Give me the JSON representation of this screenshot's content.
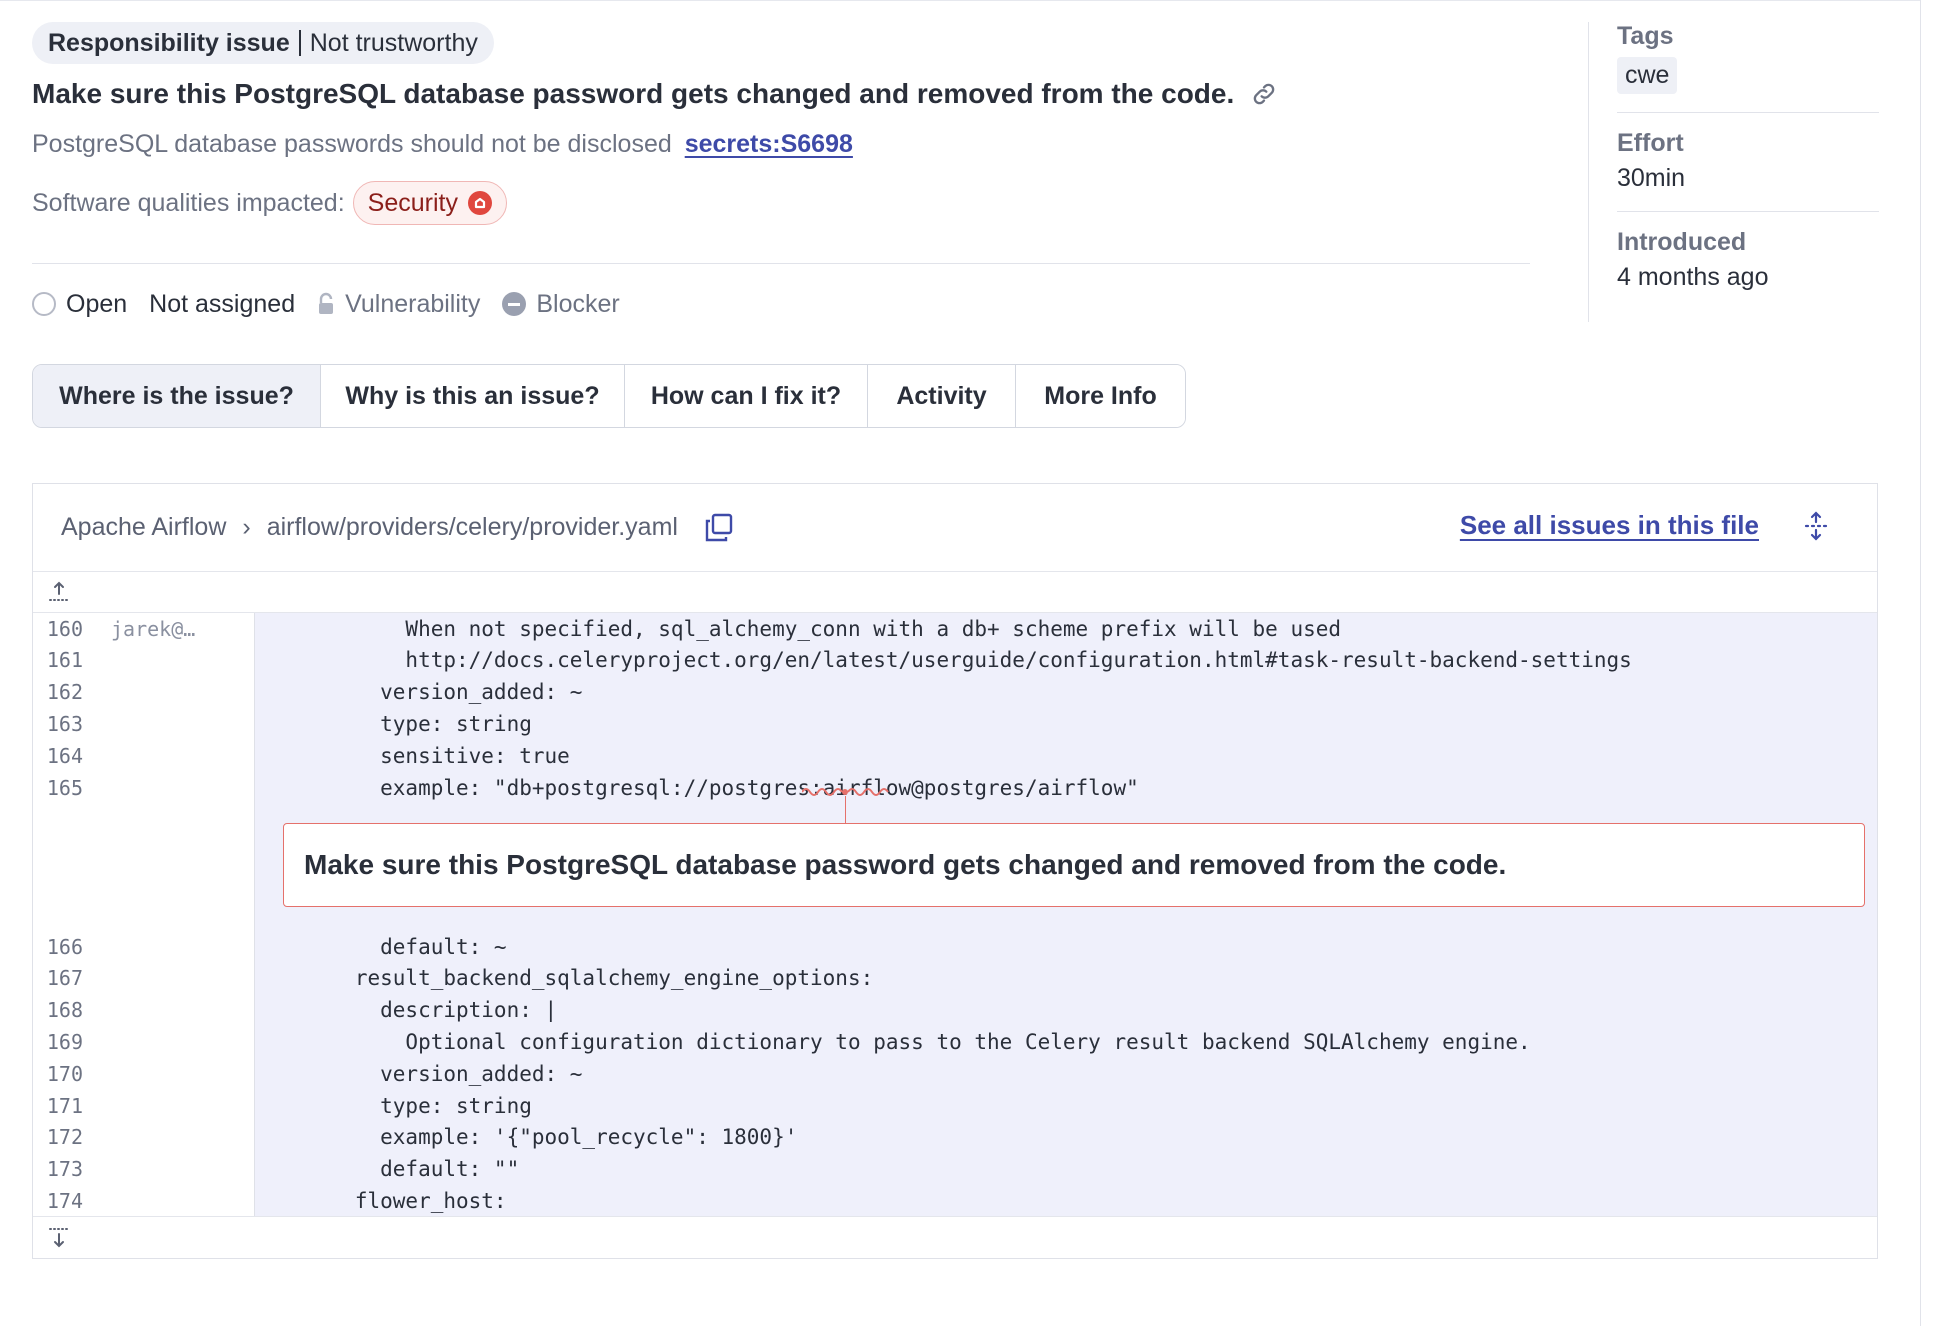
{
  "issue": {
    "badge_type": "Responsibility issue",
    "badge_attribute": "Not trustworthy",
    "title": "Make sure this PostgreSQL database password gets changed and removed from the code.",
    "rule_text": "PostgreSQL database passwords should not be disclosed",
    "rule_key": "secrets:S6698",
    "qualities_label": "Software qualities impacted:",
    "quality": "Security",
    "status": "Open",
    "assignee": "Not assigned",
    "type": "Vulnerability",
    "severity": "Blocker"
  },
  "sidebar": {
    "tags_label": "Tags",
    "tag": "cwe",
    "effort_label": "Effort",
    "effort": "30min",
    "introduced_label": "Introduced",
    "introduced": "4 months ago"
  },
  "tabs": [
    {
      "label": "Where is the issue?",
      "active": true
    },
    {
      "label": "Why is this an issue?",
      "active": false
    },
    {
      "label": "How can I fix it?",
      "active": false
    },
    {
      "label": "Activity",
      "active": false
    },
    {
      "label": "More Info",
      "active": false
    }
  ],
  "viewer": {
    "project": "Apache Airflow",
    "file_path": "airflow/providers/celery/provider.yaml",
    "see_all": "See all issues in this file",
    "lines_before": [
      {
        "n": "160",
        "blame": "jarek@…",
        "code": "          When not specified, sql_alchemy_conn with a db+ scheme prefix will be used"
      },
      {
        "n": "161",
        "blame": "",
        "code": "          http://docs.celeryproject.org/en/latest/userguide/configuration.html#task-result-backend-settings"
      },
      {
        "n": "162",
        "blame": "",
        "code": "        version_added: ~"
      },
      {
        "n": "163",
        "blame": "",
        "code": "        type: string"
      },
      {
        "n": "164",
        "blame": "",
        "code": "        sensitive: true"
      },
      {
        "n": "165",
        "blame": "",
        "code": "        example: \"db+postgresql://postgres:airflow@postgres/airflow\""
      }
    ],
    "inline_issue": "Make sure this PostgreSQL database password gets changed and removed from the code.",
    "lines_after": [
      {
        "n": "166",
        "blame": "",
        "code": "        default: ~"
      },
      {
        "n": "167",
        "blame": "",
        "code": "      result_backend_sqlalchemy_engine_options:"
      },
      {
        "n": "168",
        "blame": "",
        "code": "        description: |"
      },
      {
        "n": "169",
        "blame": "",
        "code": "          Optional configuration dictionary to pass to the Celery result backend SQLAlchemy engine."
      },
      {
        "n": "170",
        "blame": "",
        "code": "        version_added: ~"
      },
      {
        "n": "171",
        "blame": "",
        "code": "        type: string"
      },
      {
        "n": "172",
        "blame": "",
        "code": "        example: '{\"pool_recycle\": 1800}'"
      },
      {
        "n": "173",
        "blame": "",
        "code": "        default: \"\""
      },
      {
        "n": "174",
        "blame": "",
        "code": "      flower_host:"
      }
    ]
  },
  "colors": {
    "accent": "#3e4aa8",
    "security_red": "#e0473e",
    "code_bg": "#eff0fb"
  }
}
